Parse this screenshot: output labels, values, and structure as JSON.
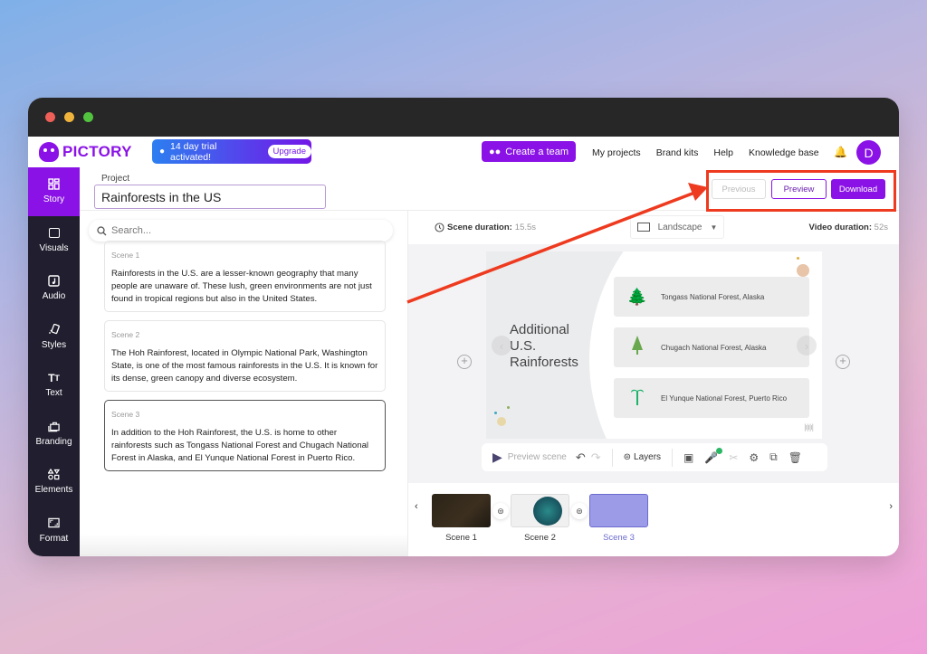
{
  "app": {
    "brand": "PICTORY"
  },
  "trial": {
    "text": "14 day trial activated!",
    "upgrade_label": "Upgrade"
  },
  "nav": {
    "create_team": "Create a team",
    "links": [
      "My projects",
      "Brand kits",
      "Help",
      "Knowledge base"
    ],
    "avatar_initial": "D"
  },
  "sidebar": {
    "items": [
      {
        "label": "Story",
        "icon": "grid-icon",
        "active": true
      },
      {
        "label": "Visuals",
        "icon": "image-icon"
      },
      {
        "label": "Audio",
        "icon": "music-icon"
      },
      {
        "label": "Styles",
        "icon": "styles-icon"
      },
      {
        "label": "Text",
        "icon": "text-icon"
      },
      {
        "label": "Branding",
        "icon": "briefcase-icon"
      },
      {
        "label": "Elements",
        "icon": "shapes-icon"
      },
      {
        "label": "Format",
        "icon": "aspect-ratio-icon"
      }
    ]
  },
  "project": {
    "label": "Project",
    "name": "Rainforests in the US"
  },
  "actions": {
    "previous": "Previous",
    "preview": "Preview",
    "download": "Download"
  },
  "search": {
    "placeholder": "Search..."
  },
  "scenes": [
    {
      "label": "Scene 1",
      "text": "Rainforests in the U.S. are a lesser-known geography that many people are unaware of. These lush, green environments are not just found in tropical regions but also in the United States."
    },
    {
      "label": "Scene 2",
      "text": "The Hoh Rainforest, located in Olympic National Park, Washington State, is one of the most famous rainforests in the U.S. It is known for its dense, green canopy and diverse ecosystem."
    },
    {
      "label": "Scene 3",
      "text": "In addition to the Hoh Rainforest, the U.S. is home to other rainforests such as Tongass National Forest and Chugach National Forest in Alaska, and El Yunque National Forest in Puerto Rico.",
      "active": true
    }
  ],
  "durations": {
    "scene_label": "Scene duration:",
    "scene_value": "15.5s",
    "orientation": "Landscape",
    "video_label": "Video duration:",
    "video_value": "52s"
  },
  "slide": {
    "title": "Additional U.S. Rainforests",
    "title_lines": [
      "Additional",
      "U.S.",
      "Rainforests"
    ],
    "rows": [
      {
        "text": "Tongass National Forest, Alaska",
        "icon": "forest-icon",
        "color": "#c8793c"
      },
      {
        "text": "Chugach National Forest, Alaska",
        "icon": "pine-tree-icon",
        "color": "#6aa84f"
      },
      {
        "text": "El Yunque National Forest, Puerto Rico",
        "icon": "palm-tree-icon",
        "color": "#1fb26b"
      }
    ]
  },
  "toolbar": {
    "preview_scene": "Preview scene",
    "layers": "Layers"
  },
  "timeline": {
    "thumbs": [
      {
        "label": "Scene 1"
      },
      {
        "label": "Scene 2"
      },
      {
        "label": "Scene 3",
        "active": true
      }
    ]
  },
  "colors": {
    "brand": "#8a12e6",
    "annotation": "#ee3a1f"
  }
}
